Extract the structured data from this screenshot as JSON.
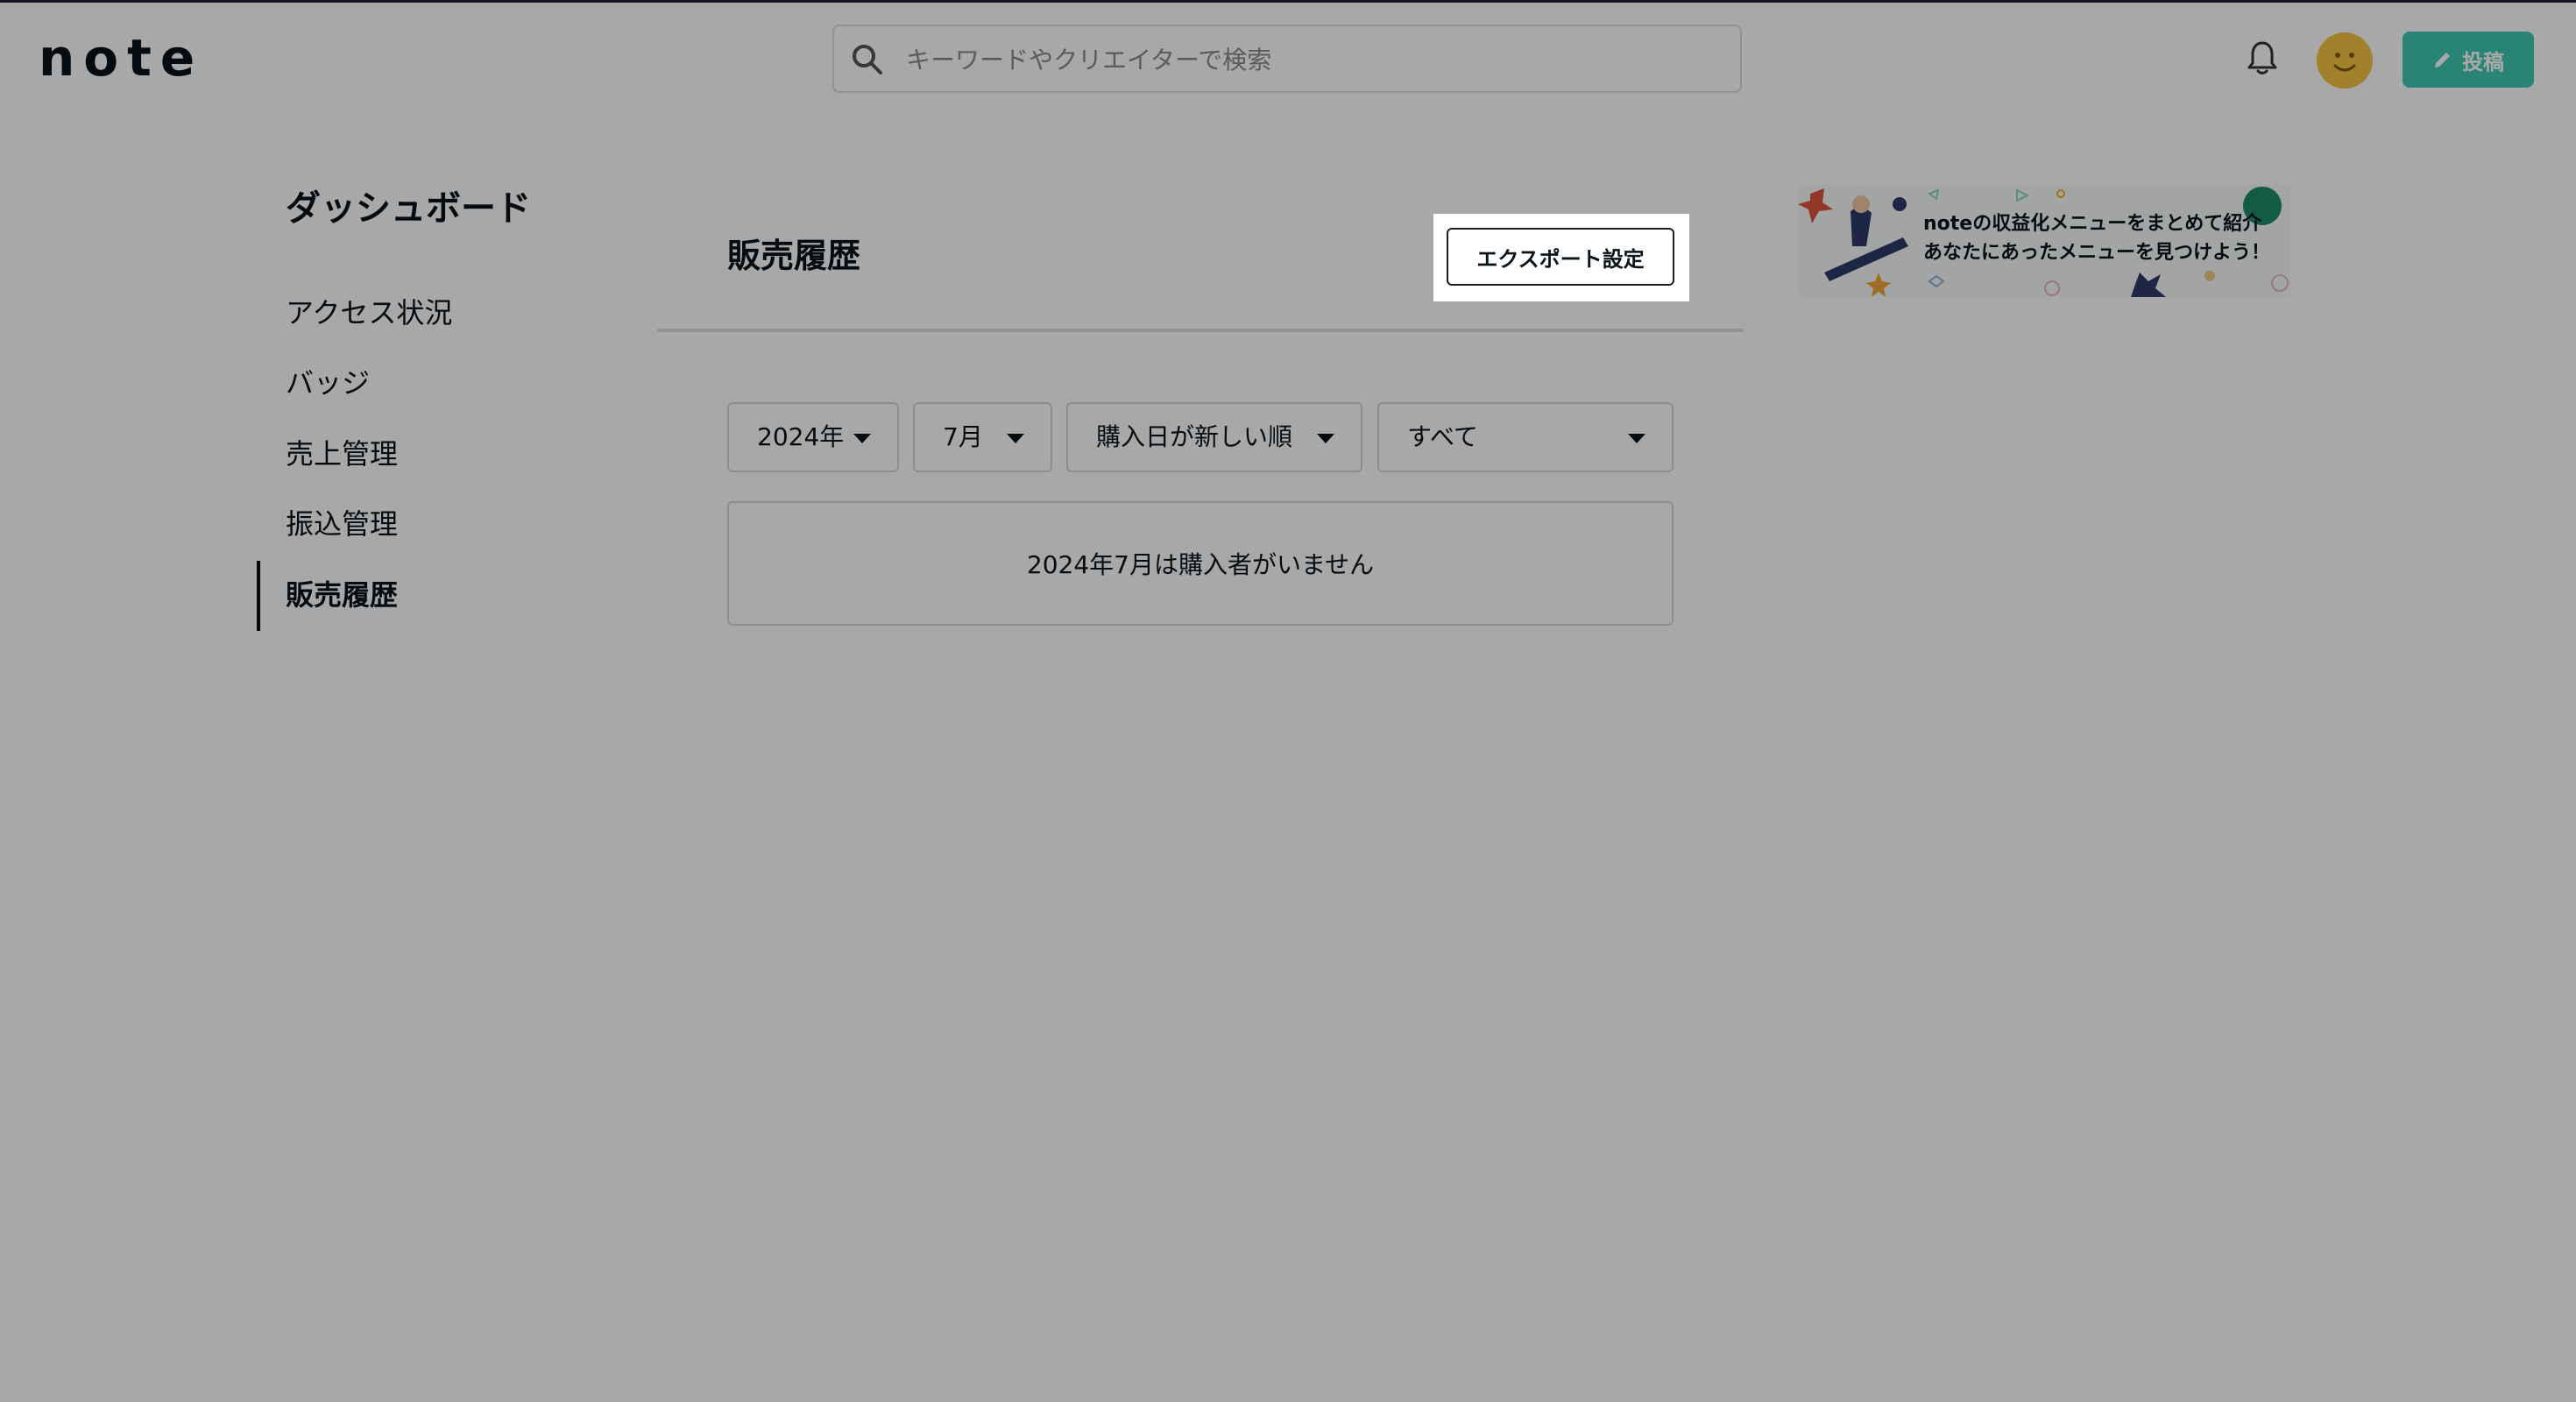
{
  "header": {
    "logo": "note",
    "search_placeholder": "キーワードやクリエイターで検索",
    "post_label": "投稿"
  },
  "sidebar": {
    "title": "ダッシュボード",
    "items": [
      {
        "label": "アクセス状況"
      },
      {
        "label": "バッジ"
      },
      {
        "label": "売上管理"
      },
      {
        "label": "振込管理"
      },
      {
        "label": "販売履歴",
        "active": true
      }
    ]
  },
  "main": {
    "title": "販売履歴",
    "export_label": "エクスポート設定",
    "filters": {
      "year": "2024年",
      "month": "7月",
      "sort": "購入日が新しい順",
      "type": "すべて"
    },
    "empty_message": "2024年7月は購入者がいません"
  },
  "banner": {
    "line1": "noteの収益化メニューをまとめて紹介",
    "line2": "あなたにあったメニューを見つけよう！"
  },
  "colors": {
    "brand_green": "#41c9b4",
    "avatar": "#f5c343",
    "text": "#08131a"
  }
}
